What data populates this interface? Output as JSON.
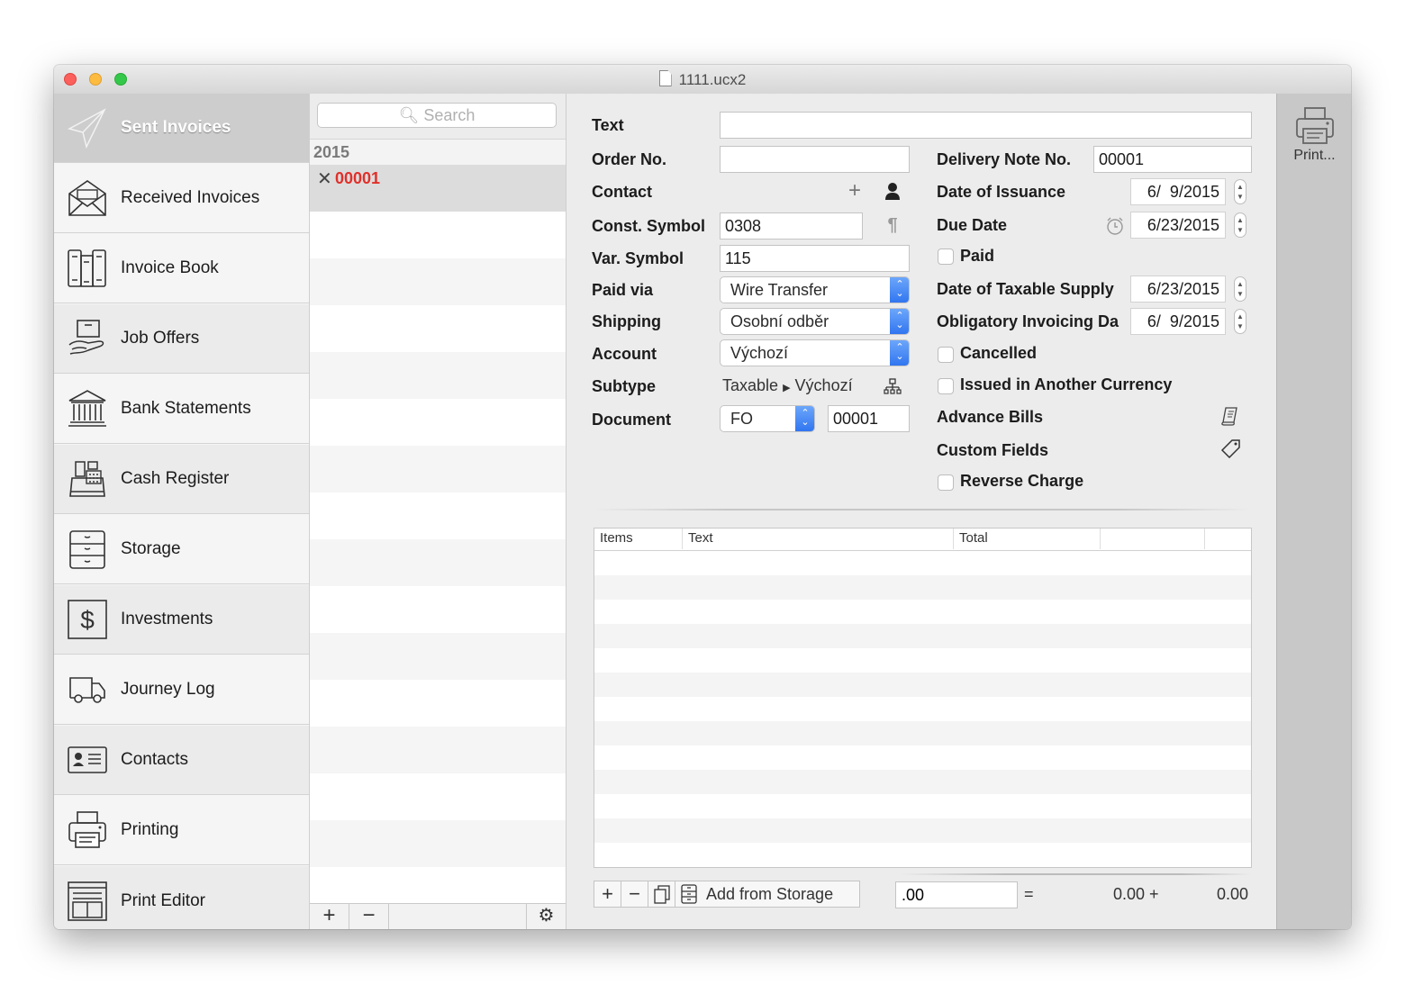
{
  "window": {
    "title": "1111.ucx2"
  },
  "sidebar": {
    "items": [
      {
        "label": "Sent Invoices",
        "icon": "paper-plane-icon",
        "active": true
      },
      {
        "label": "Received Invoices",
        "icon": "open-envelope-icon"
      },
      {
        "label": "Invoice Book",
        "icon": "binders-icon"
      },
      {
        "label": "Job Offers",
        "icon": "hand-box-icon"
      },
      {
        "label": "Bank Statements",
        "icon": "bank-icon"
      },
      {
        "label": "Cash Register",
        "icon": "cash-register-icon"
      },
      {
        "label": "Storage",
        "icon": "cabinet-icon"
      },
      {
        "label": "Investments",
        "icon": "dollar-icon"
      },
      {
        "label": "Journey Log",
        "icon": "truck-icon"
      },
      {
        "label": "Contacts",
        "icon": "contact-card-icon"
      },
      {
        "label": "Printing",
        "icon": "printer-icon"
      },
      {
        "label": "Print Editor",
        "icon": "layout-icon"
      }
    ]
  },
  "list": {
    "search_placeholder": "Search",
    "group": "2015",
    "items": [
      {
        "number": "00001",
        "status_icon": "x-mark-icon"
      }
    ],
    "add_label": "+",
    "remove_label": "−"
  },
  "form": {
    "left": {
      "text_label": "Text",
      "text_value": "",
      "order_label": "Order No.",
      "order_value": "",
      "contact_label": "Contact",
      "const_label": "Const. Symbol",
      "const_value": "0308",
      "var_label": "Var. Symbol",
      "var_value": "115",
      "paid_via_label": "Paid via",
      "paid_via_value": "Wire Transfer",
      "shipping_label": "Shipping",
      "shipping_value": "Osobní odběr",
      "account_label": "Account",
      "account_value": "Výchozí",
      "subtype_label": "Subtype",
      "subtype_value_1": "Taxable",
      "subtype_value_2": "Výchozí",
      "document_label": "Document",
      "document_type": "FO",
      "document_number": "00001"
    },
    "right": {
      "delivery_label": "Delivery Note No.",
      "delivery_value": "00001",
      "issuance_label": "Date of Issuance",
      "issuance_value": "6/  9/2015",
      "due_label": "Due Date",
      "due_value": "6/23/2015",
      "paid_label": "Paid",
      "paid_checked": false,
      "taxable_label": "Date of Taxable Supply",
      "taxable_value": "6/23/2015",
      "obligatory_label": "Obligatory Invoicing Da",
      "obligatory_value": "6/  9/2015",
      "cancelled_label": "Cancelled",
      "cancelled_checked": false,
      "currency_label": "Issued in Another Currency",
      "currency_checked": false,
      "advance_label": "Advance Bills",
      "custom_label": "Custom Fields",
      "reverse_label": "Reverse Charge",
      "reverse_checked": false
    }
  },
  "items_table": {
    "columns": [
      "Items",
      "Text",
      "Total",
      "",
      ""
    ],
    "rows": []
  },
  "footer": {
    "add_from_storage": "Add from Storage",
    "discount_value": ".00",
    "equals": "=",
    "subtotal": "0.00 +",
    "total": "0.00"
  },
  "toolbar": {
    "print_label": "Print..."
  }
}
